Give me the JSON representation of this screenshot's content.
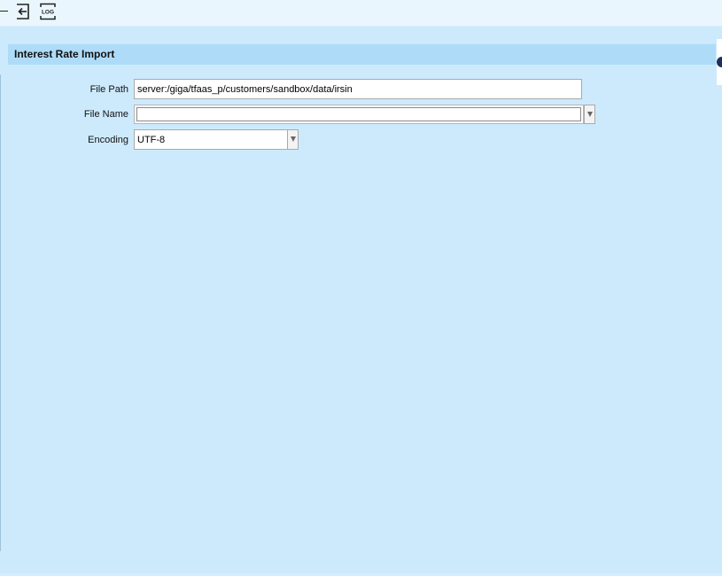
{
  "toolbar": {
    "exit_icon": "exit-icon",
    "log_icon": "log-icon",
    "log_label": "LOG"
  },
  "panel": {
    "title": "Interest Rate Import"
  },
  "form": {
    "file_path": {
      "label": "File Path",
      "value": "server:/giga/tfaas_p/customers/sandbox/data/irsin"
    },
    "file_name": {
      "label": "File Name",
      "value": ""
    },
    "encoding": {
      "label": "Encoding",
      "value": "UTF-8"
    }
  },
  "colors": {
    "background": "#cdeafd",
    "header": "#aedcf8",
    "toolbar": "#eaf6fe"
  }
}
